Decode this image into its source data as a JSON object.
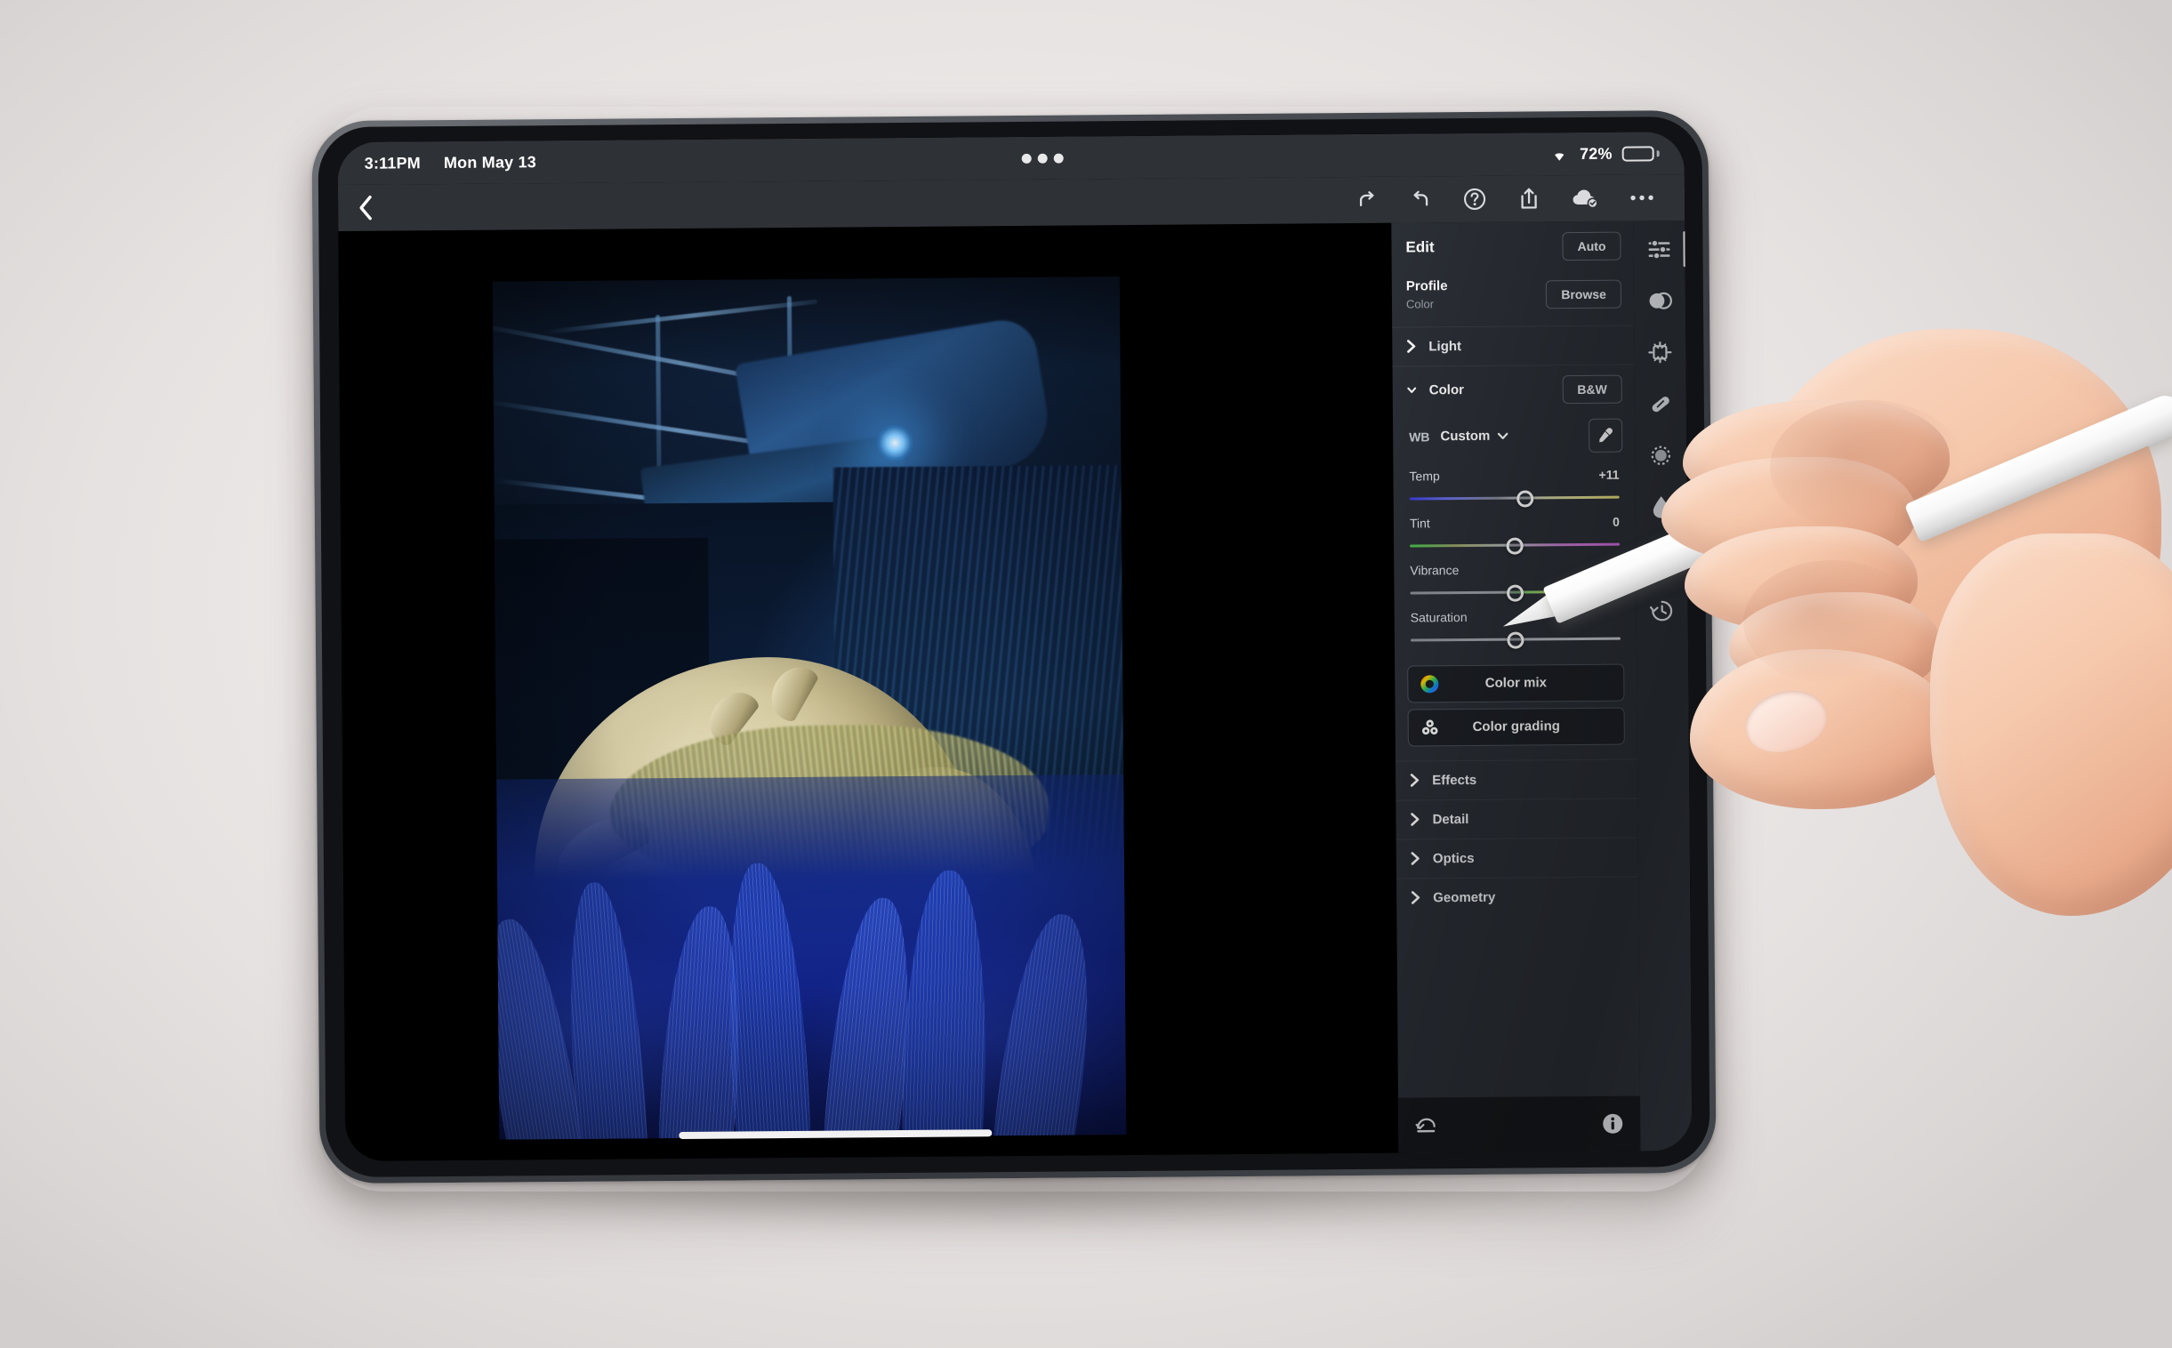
{
  "status_bar": {
    "time": "3:11PM",
    "date": "Mon May 13",
    "battery_percent": "72%",
    "battery_level": 72,
    "wifi_icon": "wifi-icon",
    "multitask_icon": "multitask-dots-icon"
  },
  "toolbar": {
    "back_icon": "chevron-left-icon",
    "icons": [
      {
        "name": "redo-icon",
        "label": "Redo"
      },
      {
        "name": "undo-icon",
        "label": "Undo"
      },
      {
        "name": "help-icon",
        "label": "Help"
      },
      {
        "name": "share-icon",
        "label": "Share"
      },
      {
        "name": "cloud-sync-icon",
        "label": "Cloud sync"
      },
      {
        "name": "more-icon",
        "label": "More"
      }
    ]
  },
  "panel": {
    "title": "Edit",
    "auto_label": "Auto",
    "profile_label": "Profile",
    "profile_value": "Color",
    "browse_label": "Browse",
    "bw_label": "B&W",
    "wb_label": "WB",
    "wb_value": "Custom",
    "eyedropper_icon": "eyedropper-icon",
    "sections": [
      {
        "name": "light",
        "label": "Light",
        "expanded": false
      },
      {
        "name": "color",
        "label": "Color",
        "expanded": true
      },
      {
        "name": "effects",
        "label": "Effects",
        "expanded": false
      },
      {
        "name": "detail",
        "label": "Detail",
        "expanded": false
      },
      {
        "name": "optics",
        "label": "Optics",
        "expanded": false
      },
      {
        "name": "geometry",
        "label": "Geometry",
        "expanded": false
      }
    ],
    "sliders": [
      {
        "name": "temp",
        "label": "Temp",
        "value": "+11",
        "position_pct": 55
      },
      {
        "name": "tint",
        "label": "Tint",
        "value": "0",
        "position_pct": 50
      },
      {
        "name": "vibrance",
        "label": "Vibrance",
        "value": "0",
        "position_pct": 50
      },
      {
        "name": "saturation",
        "label": "Saturation",
        "value": "",
        "position_pct": 50
      }
    ],
    "color_mix_label": "Color mix",
    "color_grading_label": "Color grading",
    "reset_icon": "reset-icon",
    "info_icon": "info-icon"
  },
  "rail": {
    "items": [
      {
        "name": "edit-sliders-icon",
        "label": "Edit",
        "active": true
      },
      {
        "name": "masking-icon",
        "label": "Masking",
        "active": false
      },
      {
        "name": "crop-icon",
        "label": "Crop",
        "active": false
      },
      {
        "name": "healing-icon",
        "label": "Healing",
        "active": false
      },
      {
        "name": "selective-icon",
        "label": "Selective",
        "active": false
      },
      {
        "name": "water-drop-icon",
        "label": "Retouch",
        "active": false
      },
      {
        "name": "presets-icon",
        "label": "Presets",
        "active": false
      },
      {
        "name": "version-history-icon",
        "label": "Versions",
        "active": false
      }
    ]
  },
  "photo": {
    "alt": "Blue-lit dinosaur exhibit with armoured dinosaur and glowing blue ferns"
  },
  "home_indicator": {
    "name": "home-indicator"
  },
  "colors": {
    "panel_bg": "#2b2f36",
    "status_bg": "#2e3136",
    "panel_foot_bg": "#16181c",
    "accent_white": "#ffffff",
    "muted_text": "#9aa1ab",
    "desk_bg": "#eeeae9"
  }
}
